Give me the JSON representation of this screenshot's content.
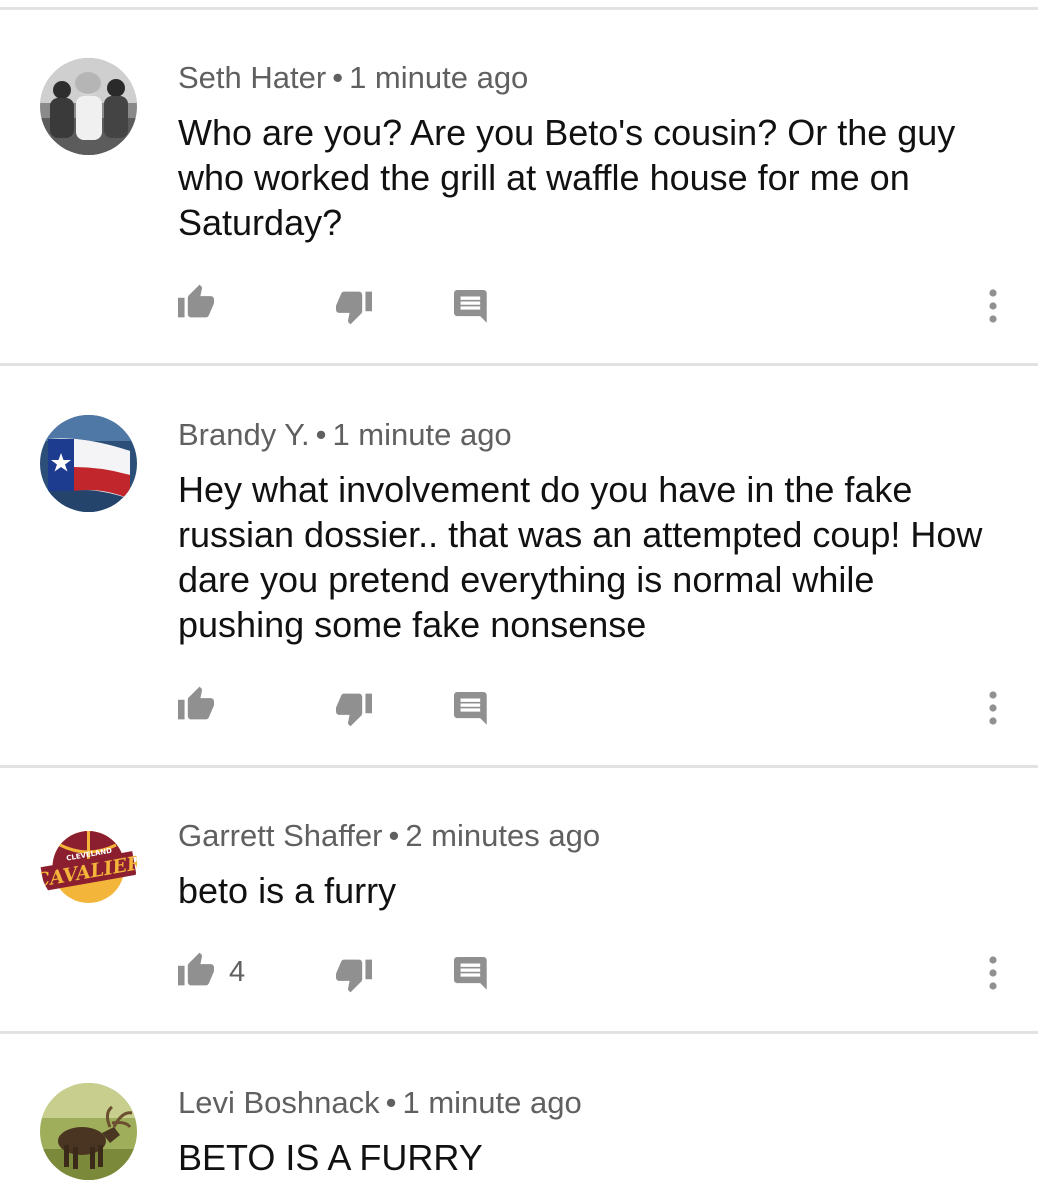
{
  "comments": [
    {
      "author": "Seth Hater",
      "time": "1 minute ago",
      "text": "Who are you?  Are you Beto's cousin? Or the guy who worked the grill at waffle house for me on Saturday?",
      "likes": "",
      "avatar": "photo-of-three-people"
    },
    {
      "author": "Brandy Y.",
      "time": "1 minute ago",
      "text": "Hey what involvement do you have in the fake russian dossier.. that was an attempted coup! How dare you pretend everything is normal while pushing some fake nonsense",
      "likes": "",
      "avatar": "texas-flag"
    },
    {
      "author": "Garrett Shaffer",
      "time": "2 minutes ago",
      "text": "beto is a furry",
      "likes": "4",
      "avatar": "cleveland-cavaliers-logo"
    },
    {
      "author": "Levi Boshnack",
      "time": "1 minute ago",
      "text": "BETO IS A FURRY",
      "likes": "",
      "avatar": "moose-photo"
    }
  ],
  "separator": "•",
  "icons": {
    "like": "thumbs-up-icon",
    "dislike": "thumbs-down-icon",
    "reply": "reply-comment-icon",
    "more": "more-vertical-icon"
  },
  "colors": {
    "meta_text": "#606060",
    "body_text": "#111111",
    "icon": "#909090",
    "divider": "#e2e2e2"
  }
}
